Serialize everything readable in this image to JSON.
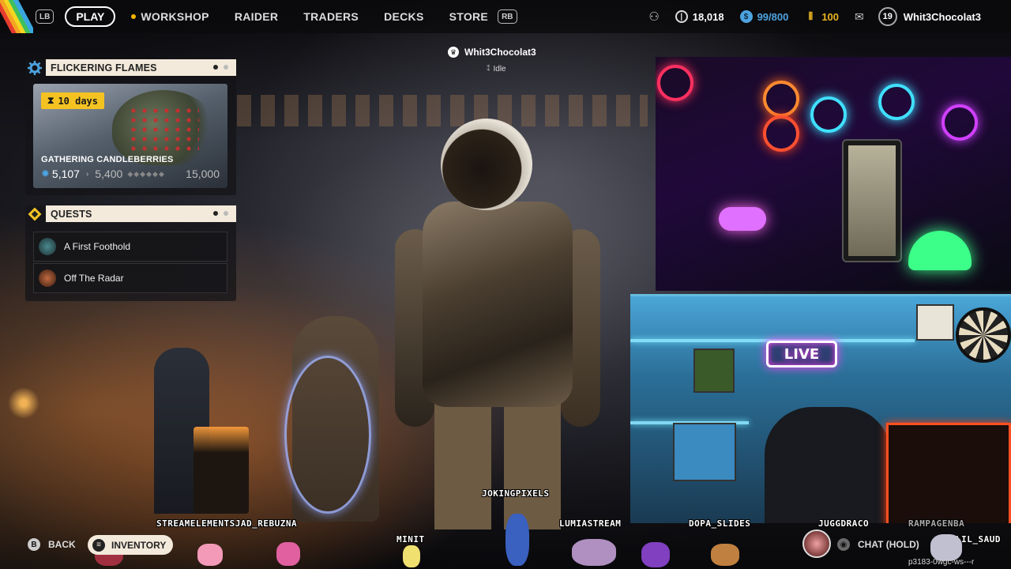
{
  "topbar": {
    "left_bumper": "LB",
    "right_bumper": "RB",
    "nav": [
      "PLAY",
      "WORKSHOP",
      "RAIDER",
      "TRADERS",
      "DECKS",
      "STORE"
    ],
    "coins": "18,018",
    "capacity": "99/800",
    "tokens": "100",
    "level": "19",
    "username": "Whit3Chocolat3"
  },
  "event_panel": {
    "title": "FLICKERING FLAMES",
    "days_left": "10 days",
    "event_name": "GATHERING CANDLEBERRIES",
    "current": "5,107",
    "next_milestone": "5,400",
    "max": "15,000"
  },
  "quests_panel": {
    "title": "QUESTS",
    "items": [
      "A First Foothold",
      "Off The Radar"
    ]
  },
  "player": {
    "name": "Whit3Chocolat3",
    "status": "Idle"
  },
  "bottom": {
    "back_key": "B",
    "back_label": "BACK",
    "inventory_label": "INVENTORY",
    "chat_label": "CHAT (HOLD)",
    "code": "p3183-0wgc-ws---r"
  },
  "overlay_users": {
    "u1": "STREAMELEMENTSJAD_REBUZNA",
    "u2": "MINIT",
    "u3": "JOKINGPIXELS",
    "u4": "LUMIASTREAM",
    "u5": "DOPA_SLIDES",
    "u6": "JUGGDRACO",
    "u7": "RAMPAGENBA",
    "u8": "LIL_SAUD"
  },
  "webcam_overlay": {
    "live_sign": "LIVE"
  },
  "colors": {
    "accent_cream": "#f3eadb",
    "badge_yellow": "#f4c322",
    "currency_blue": "#4da3e0",
    "token_gold": "#e8b422"
  }
}
